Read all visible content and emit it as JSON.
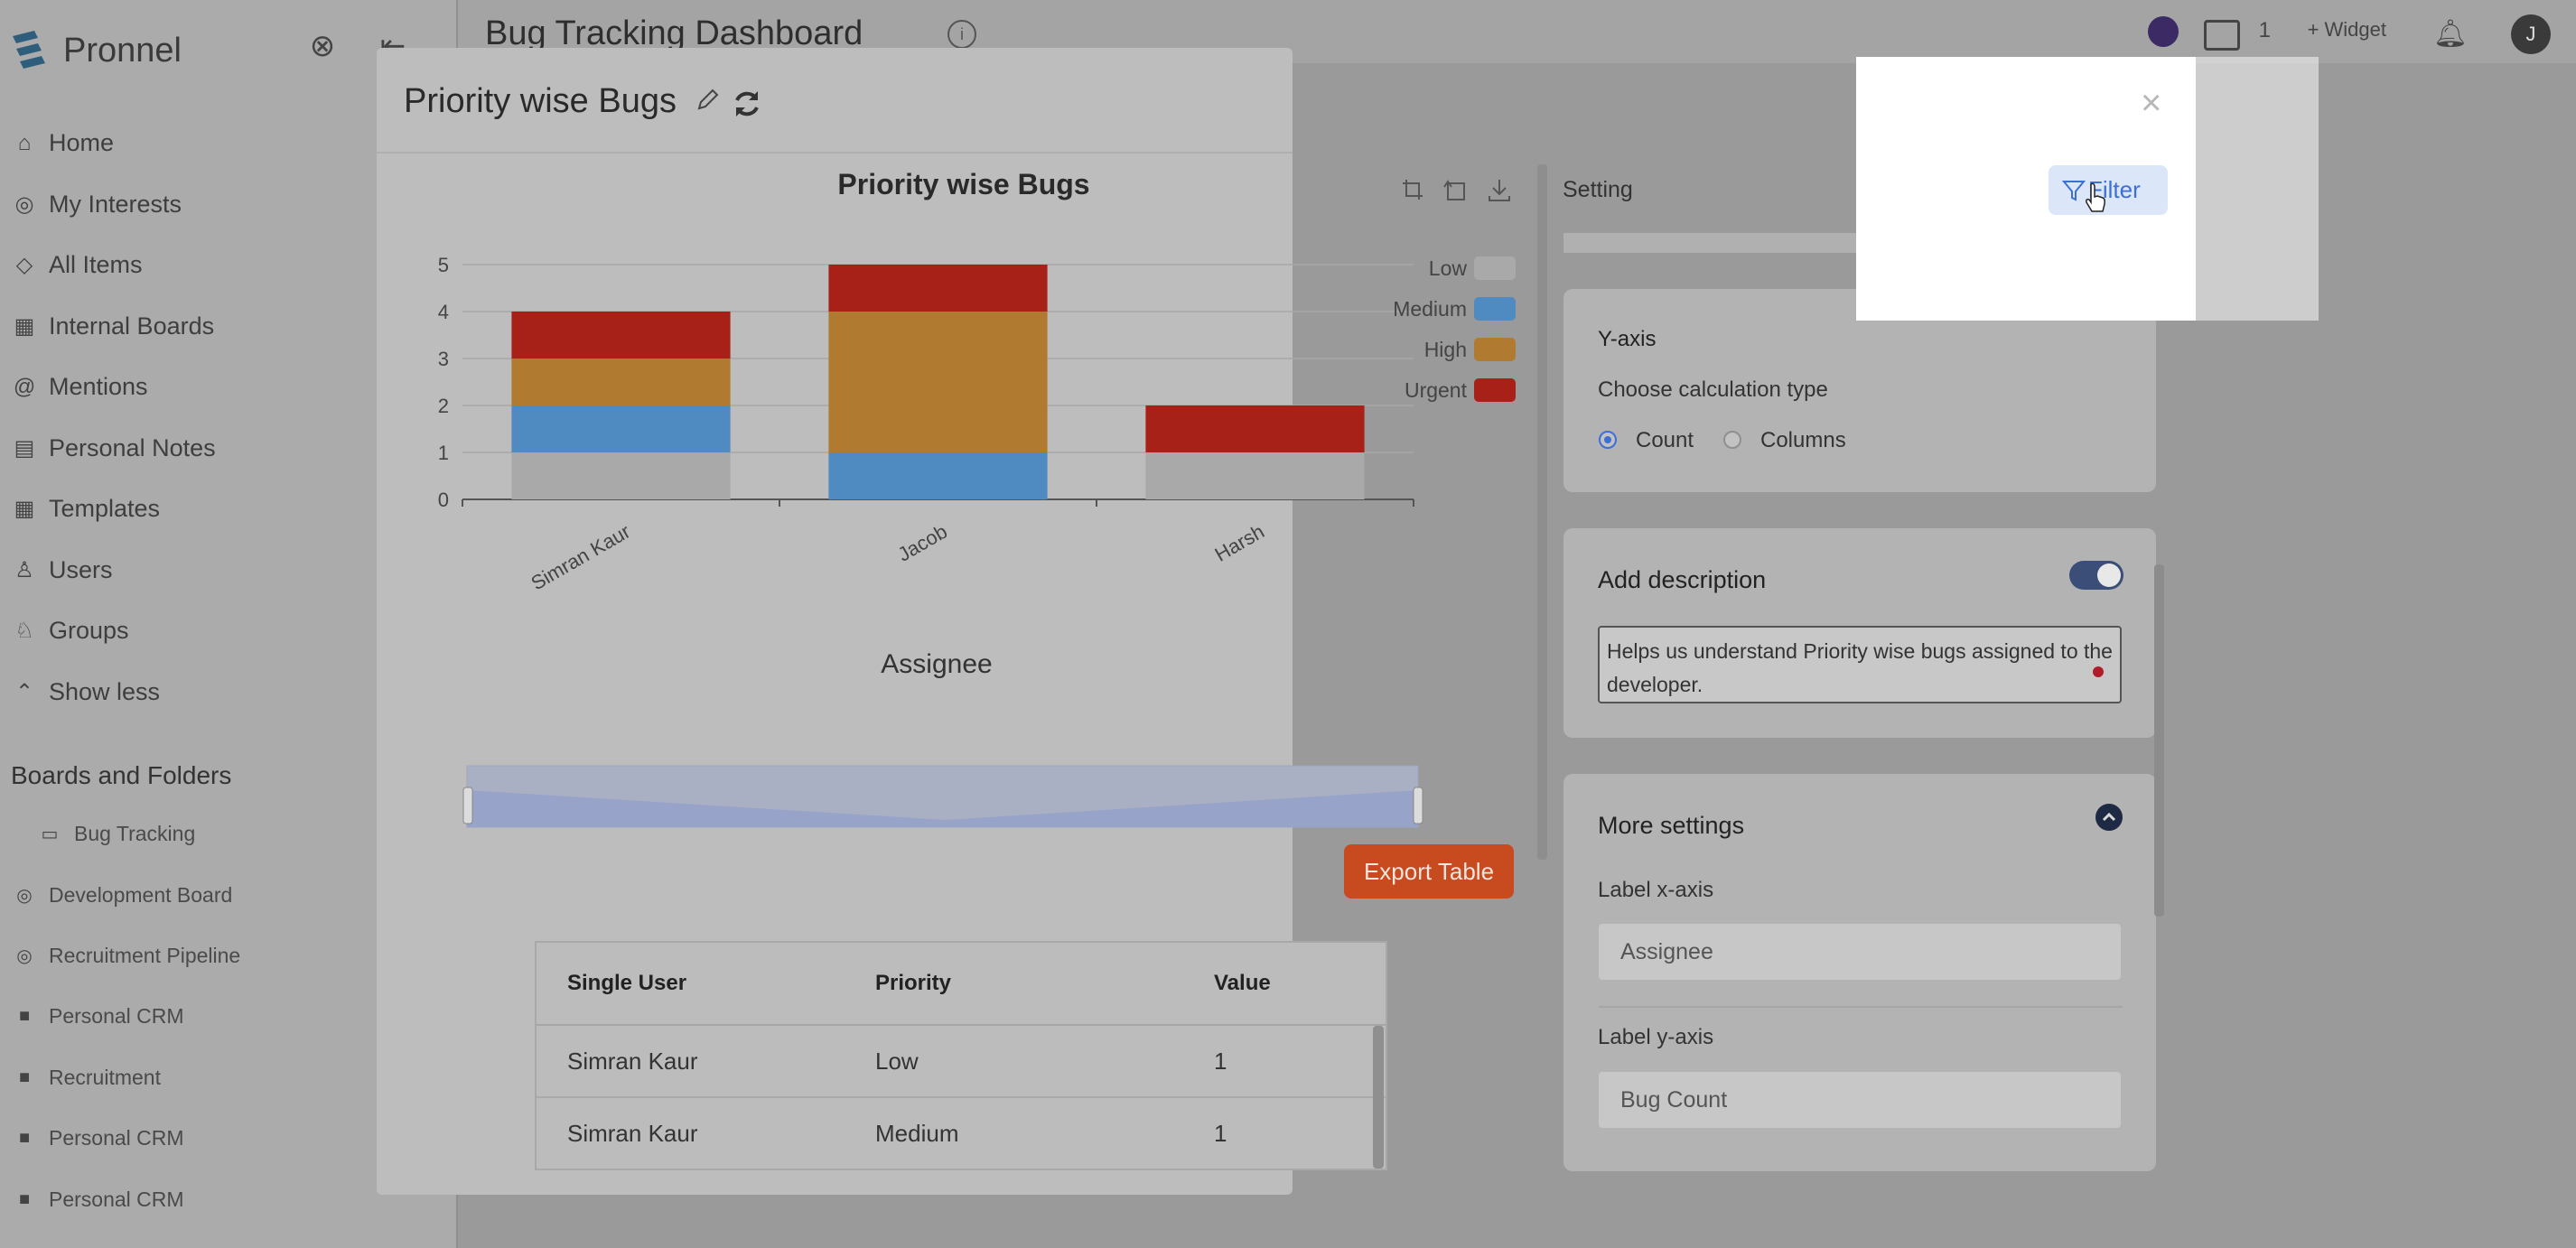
{
  "sidebar": {
    "brand": "Pronnel",
    "nav": [
      {
        "label": "Home",
        "icon": "home-icon"
      },
      {
        "label": "My Interests",
        "icon": "interests-icon"
      },
      {
        "label": "All Items",
        "icon": "items-icon"
      },
      {
        "label": "Internal Boards",
        "icon": "boards-icon"
      },
      {
        "label": "Mentions",
        "icon": "at-icon"
      },
      {
        "label": "Personal Notes",
        "icon": "notes-icon"
      },
      {
        "label": "Templates",
        "icon": "templates-icon"
      },
      {
        "label": "Users",
        "icon": "user-icon"
      },
      {
        "label": "Groups",
        "icon": "group-icon"
      },
      {
        "label": "Show less",
        "icon": "chevron-up-icon"
      }
    ],
    "section_title": "Boards and Folders",
    "folders": [
      {
        "label": "Bug Tracking",
        "sub": true
      },
      {
        "label": "Development Board",
        "sub": false
      },
      {
        "label": "Recruitment Pipeline",
        "sub": false
      },
      {
        "label": "Personal CRM",
        "sub": false
      },
      {
        "label": "Recruitment",
        "sub": false
      },
      {
        "label": "Personal CRM",
        "sub": false
      },
      {
        "label": "Personal CRM",
        "sub": false
      }
    ]
  },
  "header": {
    "title": "Bug Tracking Dashboard",
    "count": "1",
    "widget_label": "+ Widget",
    "avatar": "J"
  },
  "modal": {
    "title": "Priority wise Bugs",
    "export_label": "Export Table",
    "table": {
      "headers": [
        "Single User",
        "Priority",
        "Value"
      ],
      "rows": [
        [
          "Simran Kaur",
          "Low",
          "1"
        ],
        [
          "Simran Kaur",
          "Medium",
          "1"
        ]
      ]
    }
  },
  "settings": {
    "label": "Setting",
    "filter_label": "Filter",
    "close": "×",
    "yaxis_title": "Y-axis",
    "calc_label": "Choose calculation type",
    "calc_options": [
      "Count",
      "Columns"
    ],
    "calc_selected": "Count",
    "desc_title": "Add description",
    "desc_enabled": true,
    "desc_text": "Helps us understand Priority wise bugs assigned to the developer.",
    "more_title": "More settings",
    "xlabel_label": "Label x-axis",
    "xlabel_value": "Assignee",
    "ylabel_label": "Label y-axis",
    "ylabel_value": "Bug Count"
  },
  "chart_data": {
    "type": "bar",
    "stacked": true,
    "title": "Priority wise Bugs",
    "xlabel": "Assignee",
    "categories": [
      "Simran Kaur",
      "Jacob",
      "Harsh"
    ],
    "series": [
      {
        "name": "Low",
        "color": "#a9a9a9",
        "values": [
          1,
          0,
          1
        ]
      },
      {
        "name": "Medium",
        "color": "#4f8ac0",
        "values": [
          1,
          1,
          0
        ]
      },
      {
        "name": "High",
        "color": "#b07a30",
        "values": [
          1,
          3,
          0
        ]
      },
      {
        "name": "Urgent",
        "color": "#a82119",
        "values": [
          1,
          1,
          1
        ]
      }
    ],
    "yticks": [
      "0",
      "1",
      "2",
      "3",
      "4",
      "5"
    ],
    "ylim": [
      0,
      5
    ],
    "legend_position": "right"
  }
}
